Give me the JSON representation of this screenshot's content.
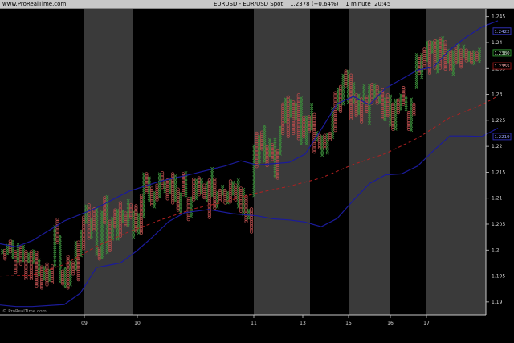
{
  "header": {
    "site": "www.ProRealTime.com",
    "title": "EURUSD - EUR/USD Spot    1.2378 (+0.64%)    1 minute  20:45"
  },
  "watermark": "© ProRealTime.com",
  "colors": {
    "background": "#000000",
    "band": "#3a3a3a",
    "x_up": "#3c8f3c",
    "o_down": "#b04a4a",
    "bollinger": "#1b1b9a",
    "moving_average": "#b02020",
    "axis_text": "#d8d8d8"
  },
  "chart_data": {
    "type": "point-and-figure",
    "x_labels": [
      "09",
      "10",
      "11",
      "13",
      "15",
      "16",
      "17"
    ],
    "y_ticks": [
      1.19,
      1.195,
      1.2,
      1.205,
      1.21,
      1.215,
      1.22,
      1.225,
      1.23,
      1.235,
      1.24,
      1.245
    ],
    "ylim": [
      1.1875,
      1.2465
    ],
    "price_badges": [
      {
        "label": "1.2422",
        "value": 1.2422,
        "color": "#2f2fb0",
        "text_color": "#9aa6ff"
      },
      {
        "label": "1.2380",
        "value": 1.238,
        "color": "#2d8f2d",
        "text_color": "#d8ffd8"
      },
      {
        "label": "1.2355",
        "value": 1.2355,
        "color": "#8a1515",
        "text_color": "#ffb0b0"
      },
      {
        "label": "1.2219",
        "value": 1.2219,
        "color": "#2f2fb0",
        "text_color": "#9aa6ff"
      }
    ],
    "pf_columns": [
      [
        1.1995,
        1.2001
      ],
      [
        1.1983,
        1.2001
      ],
      [
        1.1993,
        1.2009
      ],
      [
        1.1997,
        1.2017
      ],
      [
        1.1985,
        1.2019
      ],
      [
        1.1957,
        1.1999
      ],
      [
        1.1979,
        1.2011
      ],
      [
        1.1973,
        1.2005
      ],
      [
        1.1979,
        1.2007
      ],
      [
        1.1945,
        1.1997
      ],
      [
        1.1977,
        1.1995
      ],
      [
        1.1945,
        1.1999
      ],
      [
        1.1975,
        1.1999
      ],
      [
        1.1931,
        1.1997
      ],
      [
        1.1953,
        1.1981
      ],
      [
        1.1927,
        1.1967
      ],
      [
        1.1943,
        1.1967
      ],
      [
        1.1933,
        1.1973
      ],
      [
        1.1941,
        1.1961
      ],
      [
        1.1937,
        1.1971
      ],
      [
        1.1969,
        1.2045
      ],
      [
        1.2015,
        1.2059
      ],
      [
        1.1939,
        1.2029
      ],
      [
        1.1935,
        1.1959
      ],
      [
        1.1929,
        1.1967
      ],
      [
        1.1927,
        1.1989
      ],
      [
        1.1933,
        1.1977
      ],
      [
        1.1955,
        1.1977
      ],
      [
        1.1963,
        1.2015
      ],
      [
        1.1943,
        1.2017
      ],
      [
        1.1989,
        1.2039
      ],
      [
        1.2003,
        1.2063
      ],
      [
        1.2053,
        1.2087
      ],
      [
        1.2023,
        1.2089
      ],
      [
        1.2023,
        1.2061
      ],
      [
        1.2039,
        1.2081
      ],
      [
        1.1991,
        1.2081
      ],
      [
        1.1983,
        1.2005
      ],
      [
        1.1985,
        1.2073
      ],
      [
        1.2053,
        1.2101
      ],
      [
        1.1995,
        1.2105
      ],
      [
        1.1999,
        1.2057
      ],
      [
        1.2021,
        1.2063
      ],
      [
        1.2045,
        1.2079
      ],
      [
        1.2021,
        1.2077
      ],
      [
        1.2027,
        1.2093
      ],
      [
        1.2055,
        1.2077
      ],
      [
        1.2047,
        1.2071
      ],
      [
        1.2047,
        1.2095
      ],
      [
        1.2063,
        1.2089
      ],
      [
        1.2025,
        1.2075
      ],
      [
        1.2037,
        1.2087
      ],
      [
        1.2033,
        1.2071
      ],
      [
        1.2033,
        1.2107
      ],
      [
        1.2063,
        1.2149
      ],
      [
        1.2111,
        1.2149
      ],
      [
        1.2095,
        1.2141
      ],
      [
        1.2087,
        1.2121
      ],
      [
        1.2083,
        1.2113
      ],
      [
        1.2097,
        1.2125
      ],
      [
        1.2103,
        1.2149
      ],
      [
        1.2121,
        1.2149
      ],
      [
        1.2113,
        1.2135
      ],
      [
        1.2099,
        1.2135
      ],
      [
        1.2111,
        1.2137
      ],
      [
        1.2091,
        1.2149
      ],
      [
        1.2095,
        1.2145
      ],
      [
        1.2077,
        1.2117
      ],
      [
        1.2073,
        1.2111
      ],
      [
        1.2107,
        1.2147
      ],
      [
        1.2105,
        1.2151
      ],
      [
        1.2059,
        1.2101
      ],
      [
        1.2065,
        1.2101
      ],
      [
        1.2097,
        1.2137
      ],
      [
        1.2099,
        1.2135
      ],
      [
        1.2107,
        1.2141
      ],
      [
        1.2111,
        1.2137
      ],
      [
        1.2101,
        1.2125
      ],
      [
        1.2095,
        1.2131
      ],
      [
        1.2063,
        1.2137
      ],
      [
        1.2105,
        1.2157
      ],
      [
        1.2081,
        1.2137
      ],
      [
        1.2083,
        1.2111
      ],
      [
        1.2095,
        1.2117
      ],
      [
        1.2107,
        1.2123
      ],
      [
        1.2091,
        1.2117
      ],
      [
        1.2091,
        1.2113
      ],
      [
        1.2093,
        1.2135
      ],
      [
        1.2107,
        1.2133
      ],
      [
        1.2097,
        1.2127
      ],
      [
        1.2083,
        1.2137
      ],
      [
        1.2075,
        1.2121
      ],
      [
        1.2069,
        1.2117
      ],
      [
        1.2055,
        1.2105
      ],
      [
        1.2061,
        1.2079
      ],
      [
        1.2035,
        1.2081
      ],
      [
        1.2105,
        1.2203
      ],
      [
        1.2161,
        1.2227
      ],
      [
        1.2167,
        1.2219
      ],
      [
        1.2195,
        1.2227
      ],
      [
        1.2171,
        1.2241
      ],
      [
        1.2163,
        1.2201
      ],
      [
        1.2181,
        1.2215
      ],
      [
        1.2175,
        1.2205
      ],
      [
        1.2141,
        1.2213
      ],
      [
        1.2139,
        1.2191
      ],
      [
        1.2185,
        1.2237
      ],
      [
        1.2225,
        1.2281
      ],
      [
        1.2247,
        1.2291
      ],
      [
        1.2219,
        1.2297
      ],
      [
        1.2257,
        1.2291
      ],
      [
        1.2225,
        1.2287
      ],
      [
        1.2253,
        1.2283
      ],
      [
        1.2215,
        1.2301
      ],
      [
        1.2205,
        1.2293
      ],
      [
        1.2219,
        1.2255
      ],
      [
        1.2205,
        1.2257
      ],
      [
        1.2229,
        1.2257
      ],
      [
        1.2233,
        1.2283
      ],
      [
        1.2189,
        1.2261
      ],
      [
        1.2211,
        1.2227
      ],
      [
        1.2197,
        1.2223
      ],
      [
        1.2183,
        1.2221
      ],
      [
        1.2197,
        1.2223
      ],
      [
        1.2187,
        1.2225
      ],
      [
        1.2213,
        1.2227
      ],
      [
        1.2217,
        1.2273
      ],
      [
        1.2231,
        1.2303
      ],
      [
        1.2271,
        1.2313
      ],
      [
        1.2267,
        1.2317
      ],
      [
        1.2281,
        1.2337
      ],
      [
        1.2317,
        1.2345
      ],
      [
        1.2285,
        1.2345
      ],
      [
        1.2253,
        1.2337
      ],
      [
        1.2285,
        1.2321
      ],
      [
        1.2259,
        1.2301
      ],
      [
        1.2263,
        1.2301
      ],
      [
        1.2247,
        1.2291
      ],
      [
        1.2285,
        1.2317
      ],
      [
        1.2267,
        1.2295
      ],
      [
        1.2245,
        1.2317
      ],
      [
        1.2283,
        1.2321
      ],
      [
        1.2291,
        1.2319
      ],
      [
        1.2283,
        1.2315
      ],
      [
        1.2285,
        1.2305
      ],
      [
        1.2253,
        1.2311
      ],
      [
        1.2251,
        1.2293
      ],
      [
        1.2259,
        1.2299
      ],
      [
        1.2241,
        1.2297
      ],
      [
        1.2233,
        1.2281
      ],
      [
        1.2233,
        1.2291
      ],
      [
        1.2265,
        1.2289
      ],
      [
        1.2271,
        1.2301
      ],
      [
        1.2281,
        1.2313
      ],
      [
        1.2271,
        1.2297
      ],
      [
        1.2233,
        1.2267
      ],
      [
        1.2231,
        1.2291
      ],
      [
        1.2261,
        1.2283
      ],
      [
        1.2313,
        1.2377
      ],
      [
        1.2341,
        1.2373
      ],
      [
        1.2333,
        1.2377
      ],
      [
        1.2351,
        1.2387
      ],
      [
        1.2365,
        1.2401
      ],
      [
        1.2341,
        1.2401
      ],
      [
        1.2381,
        1.2403
      ],
      [
        1.2351,
        1.2405
      ],
      [
        1.2343,
        1.2405
      ],
      [
        1.2351,
        1.2409
      ],
      [
        1.2373,
        1.2411
      ],
      [
        1.2349,
        1.2403
      ],
      [
        1.2361,
        1.2387
      ],
      [
        1.2347,
        1.2385
      ],
      [
        1.2339,
        1.2383
      ],
      [
        1.2361,
        1.2395
      ],
      [
        1.2361,
        1.2397
      ],
      [
        1.2353,
        1.2385
      ],
      [
        1.2373,
        1.2395
      ],
      [
        1.2365,
        1.2387
      ],
      [
        1.2365,
        1.2381
      ],
      [
        1.2361,
        1.2383
      ],
      [
        1.2359,
        1.2385
      ],
      [
        1.2367,
        1.2379
      ],
      [
        1.2363,
        1.2389
      ]
    ],
    "upper_band": [
      [
        0,
        1.2012
      ],
      [
        20,
        1.2006
      ],
      [
        40,
        1.2018
      ],
      [
        80,
        1.2056
      ],
      [
        120,
        1.2081
      ],
      [
        160,
        1.2113
      ],
      [
        200,
        1.2133
      ],
      [
        240,
        1.2147
      ],
      [
        280,
        1.2162
      ],
      [
        300,
        1.2172
      ],
      [
        320,
        1.2164
      ],
      [
        360,
        1.2169
      ],
      [
        380,
        1.2185
      ],
      [
        400,
        1.2233
      ],
      [
        420,
        1.2282
      ],
      [
        440,
        1.2296
      ],
      [
        460,
        1.228
      ],
      [
        480,
        1.2312
      ],
      [
        520,
        1.2347
      ],
      [
        540,
        1.2353
      ],
      [
        560,
        1.2386
      ],
      [
        580,
        1.241
      ],
      [
        600,
        1.243
      ],
      [
        620,
        1.2442
      ]
    ],
    "lower_band": [
      [
        0,
        1.1894
      ],
      [
        20,
        1.1891
      ],
      [
        40,
        1.1891
      ],
      [
        80,
        1.1895
      ],
      [
        100,
        1.1917
      ],
      [
        120,
        1.1966
      ],
      [
        150,
        1.1975
      ],
      [
        170,
        1.1998
      ],
      [
        190,
        1.2025
      ],
      [
        210,
        1.2055
      ],
      [
        230,
        1.2072
      ],
      [
        260,
        1.2078
      ],
      [
        290,
        1.207
      ],
      [
        320,
        1.2066
      ],
      [
        340,
        1.206
      ],
      [
        360,
        1.2058
      ],
      [
        380,
        1.2054
      ],
      [
        400,
        1.2045
      ],
      [
        420,
        1.2061
      ],
      [
        440,
        1.2096
      ],
      [
        460,
        1.2128
      ],
      [
        480,
        1.2145
      ],
      [
        500,
        1.2147
      ],
      [
        520,
        1.2162
      ],
      [
        540,
        1.2192
      ],
      [
        560,
        1.222
      ],
      [
        580,
        1.222
      ],
      [
        600,
        1.2219
      ],
      [
        620,
        1.2235
      ]
    ],
    "moving_average": [
      [
        0,
        1.195
      ],
      [
        40,
        1.1952
      ],
      [
        80,
        1.1972
      ],
      [
        120,
        1.2007
      ],
      [
        160,
        1.2035
      ],
      [
        200,
        1.2058
      ],
      [
        240,
        1.2079
      ],
      [
        280,
        1.2093
      ],
      [
        320,
        1.211
      ],
      [
        360,
        1.2123
      ],
      [
        400,
        1.2139
      ],
      [
        440,
        1.2165
      ],
      [
        480,
        1.2186
      ],
      [
        520,
        1.2216
      ],
      [
        560,
        1.2255
      ],
      [
        600,
        1.228
      ],
      [
        620,
        1.2297
      ]
    ],
    "grid": false
  }
}
